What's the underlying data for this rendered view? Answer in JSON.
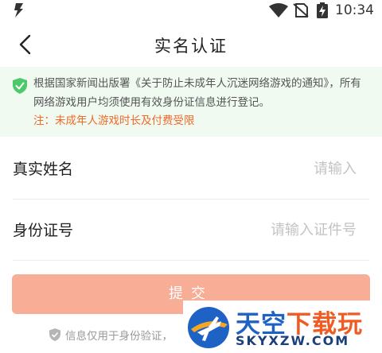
{
  "status_bar": {
    "time": "10:34",
    "icons": [
      "app-bolt-icon",
      "wifi-icon",
      "no-sim-icon",
      "battery-charging-icon"
    ]
  },
  "nav": {
    "title": "实名认证",
    "back_icon": "chevron-left-icon"
  },
  "notice": {
    "icon": "shield-check-icon",
    "text": "根据国家新闻出版署《关于防止未成年人沉迷网络游戏的通知》，所有网络游戏用户均须使用有效身份证信息进行登记。",
    "warning": "注：未成年人游戏时长及付费受限",
    "colors": {
      "background": "#f0faf1",
      "icon": "#4cc96a",
      "warning": "#f06a28"
    }
  },
  "form": {
    "name": {
      "label": "真实姓名",
      "placeholder": "请输入",
      "value": ""
    },
    "id_number": {
      "label": "身份证号",
      "placeholder": "请输入证件号",
      "value": ""
    }
  },
  "submit": {
    "label": "提交",
    "color": "#f7ad96"
  },
  "privacy": {
    "text": "信息仅用于身份验证，",
    "icon": "shield-icon"
  },
  "watermark": {
    "main_a": "天空",
    "main_b": "下载玩",
    "sub": "SKYXZW.COM",
    "icon": "airplane-logo-icon"
  }
}
